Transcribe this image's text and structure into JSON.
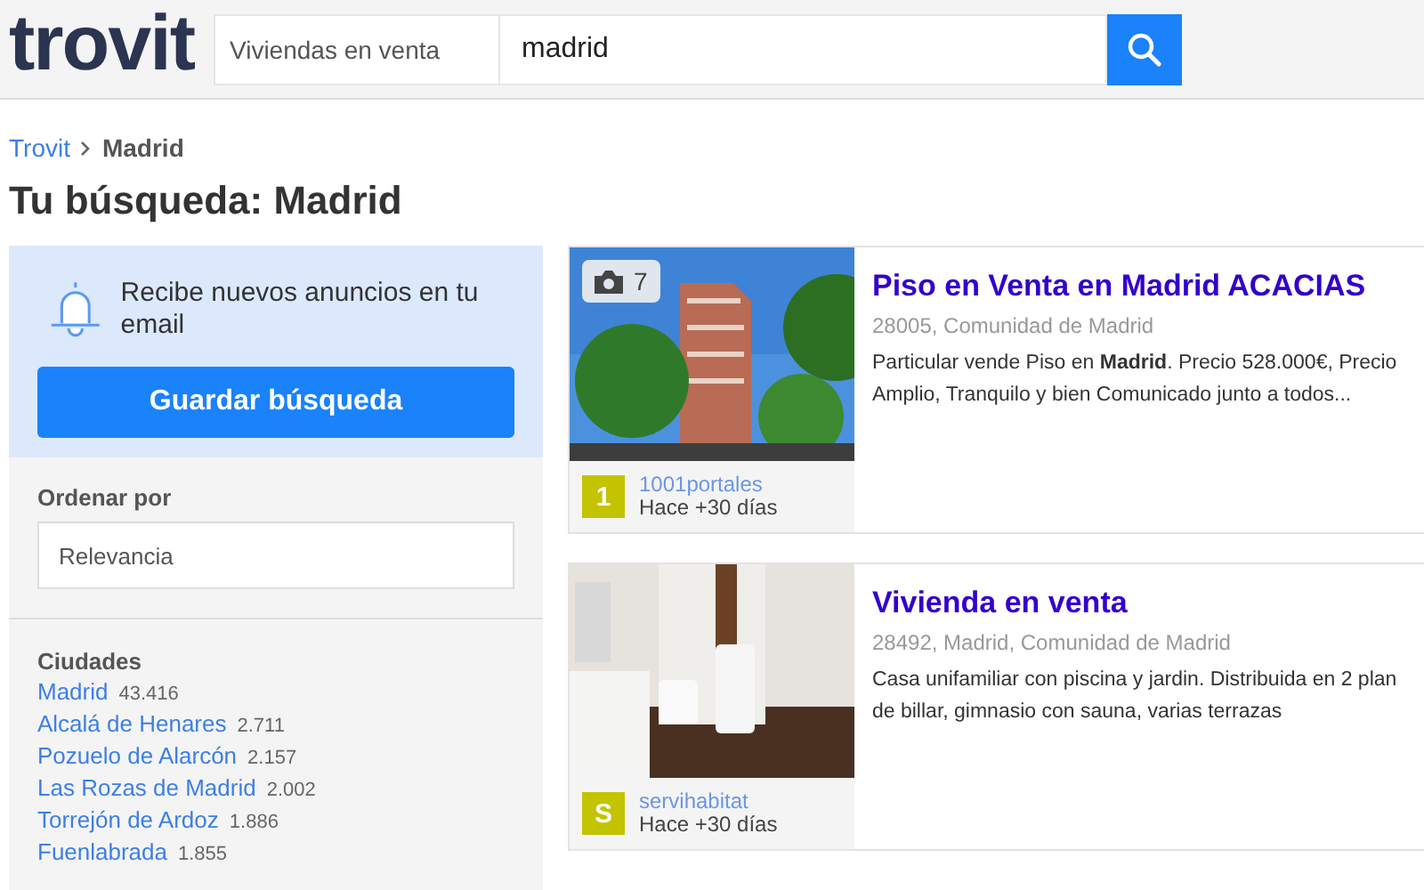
{
  "header": {
    "logo": "trovit",
    "category": "Viviendas en venta",
    "query": "madrid"
  },
  "breadcrumb": [
    {
      "label": "Trovit",
      "kind": "link"
    },
    {
      "label": "Madrid",
      "kind": "current"
    }
  ],
  "heading": "Tu búsqueda: Madrid",
  "alert": {
    "text": "Recibe nuevos anuncios en tu email",
    "button": "Guardar búsqueda"
  },
  "sort": {
    "label": "Ordenar por",
    "value": "Relevancia"
  },
  "cities": {
    "title": "Ciudades",
    "items": [
      {
        "name": "Madrid",
        "count": "43.416"
      },
      {
        "name": "Alcalá de Henares",
        "count": "2.711"
      },
      {
        "name": "Pozuelo de Alarcón",
        "count": "2.157"
      },
      {
        "name": "Las Rozas de Madrid",
        "count": "2.002"
      },
      {
        "name": "Torrejón de Ardoz",
        "count": "1.886"
      },
      {
        "name": "Fuenlabrada",
        "count": "1.855"
      }
    ]
  },
  "listings": [
    {
      "photo_count": "7",
      "title": "Piso en Venta en Madrid ACACIAS",
      "location": "28005, Comunidad de Madrid",
      "description": [
        "Particular vende Piso en **Madrid**. Precio 528.000€, Precio",
        "Amplio, Tranquilo y bien Comunicado junto a todos..."
      ],
      "source_badge": "1",
      "source": "1001portales",
      "age": "Hace +30 días"
    },
    {
      "title": "Vivienda en venta",
      "location": "28492, Madrid, Comunidad de Madrid",
      "description": [
        "Casa unifamiliar con piscina y jardin. Distribuida en 2 plan",
        "de billar, gimnasio con sauna, varias terrazas"
      ],
      "source_badge": "S",
      "source": "servihabitat",
      "age": "Hace +30 días"
    }
  ]
}
